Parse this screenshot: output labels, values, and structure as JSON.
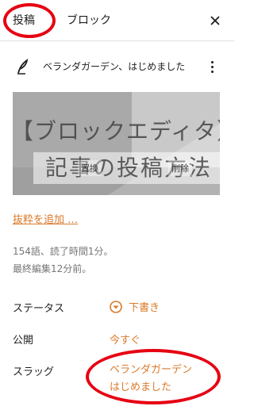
{
  "tabs": {
    "post": "投稿",
    "block": "ブロック"
  },
  "header": {
    "close_icon": "close-icon"
  },
  "post": {
    "title": "ベランダガーデン、はじめました",
    "icon": "feather-icon",
    "more_icon": "more-vertical-icon"
  },
  "featured_image": {
    "text_line1": "【ブロックエディタ】",
    "text_line2": "記事の投稿方法",
    "replace_label": "置換",
    "delete_label": "削除"
  },
  "excerpt": {
    "add_label": "抜粋を追加 …"
  },
  "stats": {
    "words": "154語、読了時間1分。",
    "last_edited": "最終編集12分前。"
  },
  "settings": {
    "status_label": "ステータス",
    "status_value": "下書き",
    "publish_label": "公開",
    "publish_value": "今すぐ",
    "slug_label": "スラッグ",
    "slug_value_line1": "ベランダガーデン",
    "slug_value_line2": "はじめました"
  },
  "colors": {
    "accent": "#d97a2a",
    "annotation": "#e60012"
  }
}
